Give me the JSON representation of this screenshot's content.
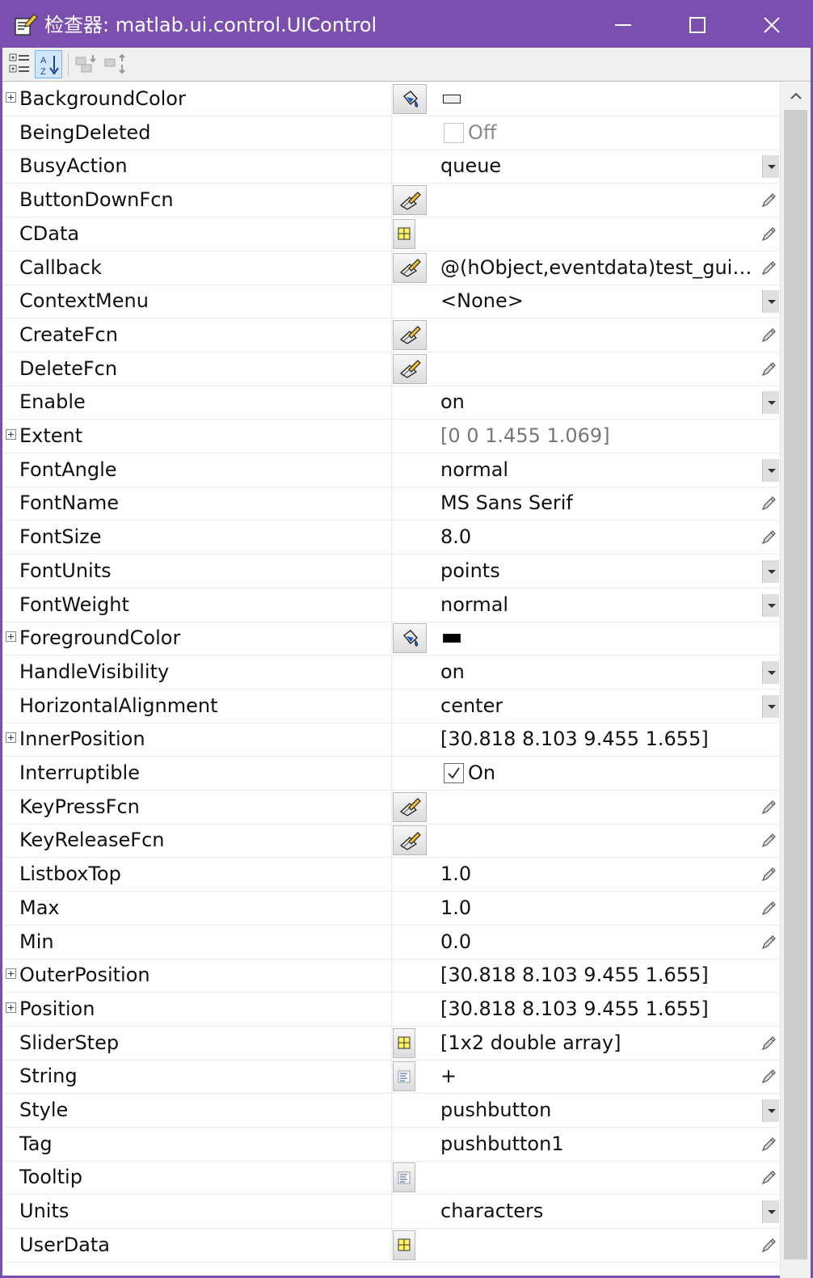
{
  "window": {
    "title": "检查器:  matlab.ui.control.UIControl",
    "controls": {
      "minimize": "minimize",
      "maximize": "maximize",
      "close": "close"
    },
    "colors": {
      "titlebar": "#7a4fb0",
      "selection": "#cfe6fb"
    }
  },
  "toolbar": {
    "buttons": [
      {
        "name": "categorize-icon"
      },
      {
        "name": "sort-alphabetical-icon",
        "active": true
      },
      {
        "name": "expand-all-icon"
      },
      {
        "name": "collapse-all-icon"
      }
    ]
  },
  "properties": [
    {
      "name": "BackgroundColor",
      "expand": true,
      "editor": "color",
      "swatch": "light"
    },
    {
      "name": "BeingDeleted",
      "checkbox": {
        "checked": false,
        "disabled": true,
        "label": "Off"
      }
    },
    {
      "name": "BusyAction",
      "value": "queue",
      "dropdown": true
    },
    {
      "name": "ButtonDownFcn",
      "editor": "callback",
      "pencil": true
    },
    {
      "name": "CData",
      "editor": "matrix",
      "pencil": true
    },
    {
      "name": "Callback",
      "editor": "callback",
      "value": "@(hObject,eventdata)test_gui('p...",
      "pencil": true
    },
    {
      "name": "ContextMenu",
      "value": "<None>",
      "dropdown": true
    },
    {
      "name": "CreateFcn",
      "editor": "callback",
      "pencil": true
    },
    {
      "name": "DeleteFcn",
      "editor": "callback",
      "pencil": true
    },
    {
      "name": "Enable",
      "value": "on",
      "dropdown": true
    },
    {
      "name": "Extent",
      "expand": true,
      "value": "[0 0 1.455 1.069]",
      "readonly": true
    },
    {
      "name": "FontAngle",
      "value": "normal",
      "dropdown": true
    },
    {
      "name": "FontName",
      "value": "MS Sans Serif",
      "pencil": true
    },
    {
      "name": "FontSize",
      "value": "8.0",
      "pencil": true
    },
    {
      "name": "FontUnits",
      "value": "points",
      "dropdown": true
    },
    {
      "name": "FontWeight",
      "value": "normal",
      "dropdown": true
    },
    {
      "name": "ForegroundColor",
      "expand": true,
      "editor": "color",
      "swatch": "dark"
    },
    {
      "name": "HandleVisibility",
      "value": "on",
      "dropdown": true
    },
    {
      "name": "HorizontalAlignment",
      "value": "center",
      "dropdown": true
    },
    {
      "name": "InnerPosition",
      "expand": true,
      "value": "[30.818 8.103 9.455 1.655]"
    },
    {
      "name": "Interruptible",
      "checkbox": {
        "checked": true,
        "disabled": false,
        "label": "On"
      }
    },
    {
      "name": "KeyPressFcn",
      "editor": "callback",
      "pencil": true
    },
    {
      "name": "KeyReleaseFcn",
      "editor": "callback",
      "pencil": true
    },
    {
      "name": "ListboxTop",
      "value": "1.0",
      "pencil": true
    },
    {
      "name": "Max",
      "value": "1.0",
      "pencil": true
    },
    {
      "name": "Min",
      "value": "0.0",
      "pencil": true
    },
    {
      "name": "OuterPosition",
      "expand": true,
      "value": "[30.818 8.103 9.455 1.655]"
    },
    {
      "name": "Position",
      "expand": true,
      "value": "[30.818 8.103 9.455 1.655]"
    },
    {
      "name": "SliderStep",
      "editor": "matrix",
      "value": "[1x2  double array]",
      "pencil": true
    },
    {
      "name": "String",
      "editor": "text",
      "value": "+",
      "pencil": true
    },
    {
      "name": "Style",
      "value": "pushbutton",
      "dropdown": true
    },
    {
      "name": "Tag",
      "value": "pushbutton1",
      "pencil": true
    },
    {
      "name": "Tooltip",
      "editor": "text",
      "pencil": true
    },
    {
      "name": "Units",
      "value": "characters",
      "dropdown": true
    },
    {
      "name": "UserData",
      "editor": "matrix",
      "pencil": true
    }
  ]
}
